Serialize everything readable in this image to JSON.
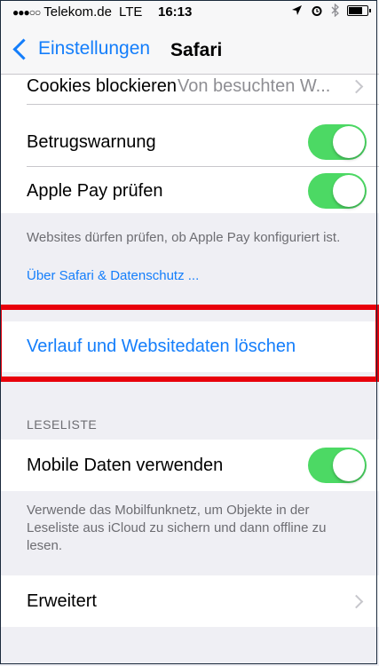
{
  "status_bar": {
    "signal": "●●●○○",
    "carrier": "Telekom.de",
    "network": "LTE",
    "time": "16:13",
    "icons": [
      "location-arrow-icon",
      "alarm-icon",
      "bluetooth-icon",
      "battery-icon"
    ]
  },
  "nav": {
    "back_label": "Einstellungen",
    "title": "Safari"
  },
  "rows": {
    "cookies": {
      "label": "Cookies blockieren",
      "value": "Von besuchten W..."
    },
    "fraud_warning": {
      "label": "Betrugswarnung",
      "on": true
    },
    "apple_pay": {
      "label": "Apple Pay prüfen",
      "on": true
    }
  },
  "footer1": {
    "text": "Websites dürfen prüfen, ob Apple Pay konfiguriert ist.",
    "link": "Über Safari & Datenschutz ..."
  },
  "clear_history": {
    "label": "Verlauf und Websitedaten löschen"
  },
  "reading_list": {
    "header": "LESELISTE",
    "mobile_data": {
      "label": "Mobile Daten verwenden",
      "on": true
    },
    "footer": "Verwende das Mobilfunknetz, um Objekte in der Leseliste aus iCloud zu sichern und dann offline zu lesen."
  },
  "advanced": {
    "label": "Erweitert"
  },
  "colors": {
    "accent": "#147efb",
    "toggle_on": "#4cd964",
    "highlight": "#e8000b",
    "background": "#efeff4"
  }
}
